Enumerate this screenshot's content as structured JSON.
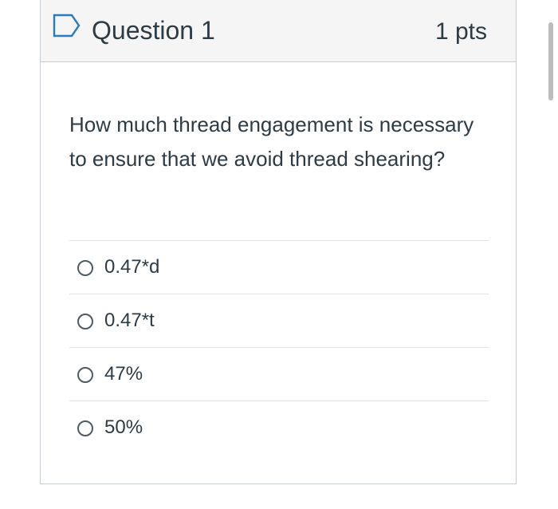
{
  "question": {
    "title": "Question 1",
    "points": "1 pts",
    "text": "How much thread engagement is necessary to ensure that we avoid thread shearing?"
  },
  "answers": [
    {
      "label": "0.47*d",
      "selected": false
    },
    {
      "label": "0.47*t",
      "selected": false
    },
    {
      "label": "47%",
      "selected": false
    },
    {
      "label": "50%",
      "selected": false
    }
  ],
  "icons": {
    "flag": "flag-icon",
    "radio": "radio-icon"
  },
  "colors": {
    "flag_accent": "#2b7abc",
    "text": "#2d3b45",
    "header_bg": "#f5f5f5"
  }
}
